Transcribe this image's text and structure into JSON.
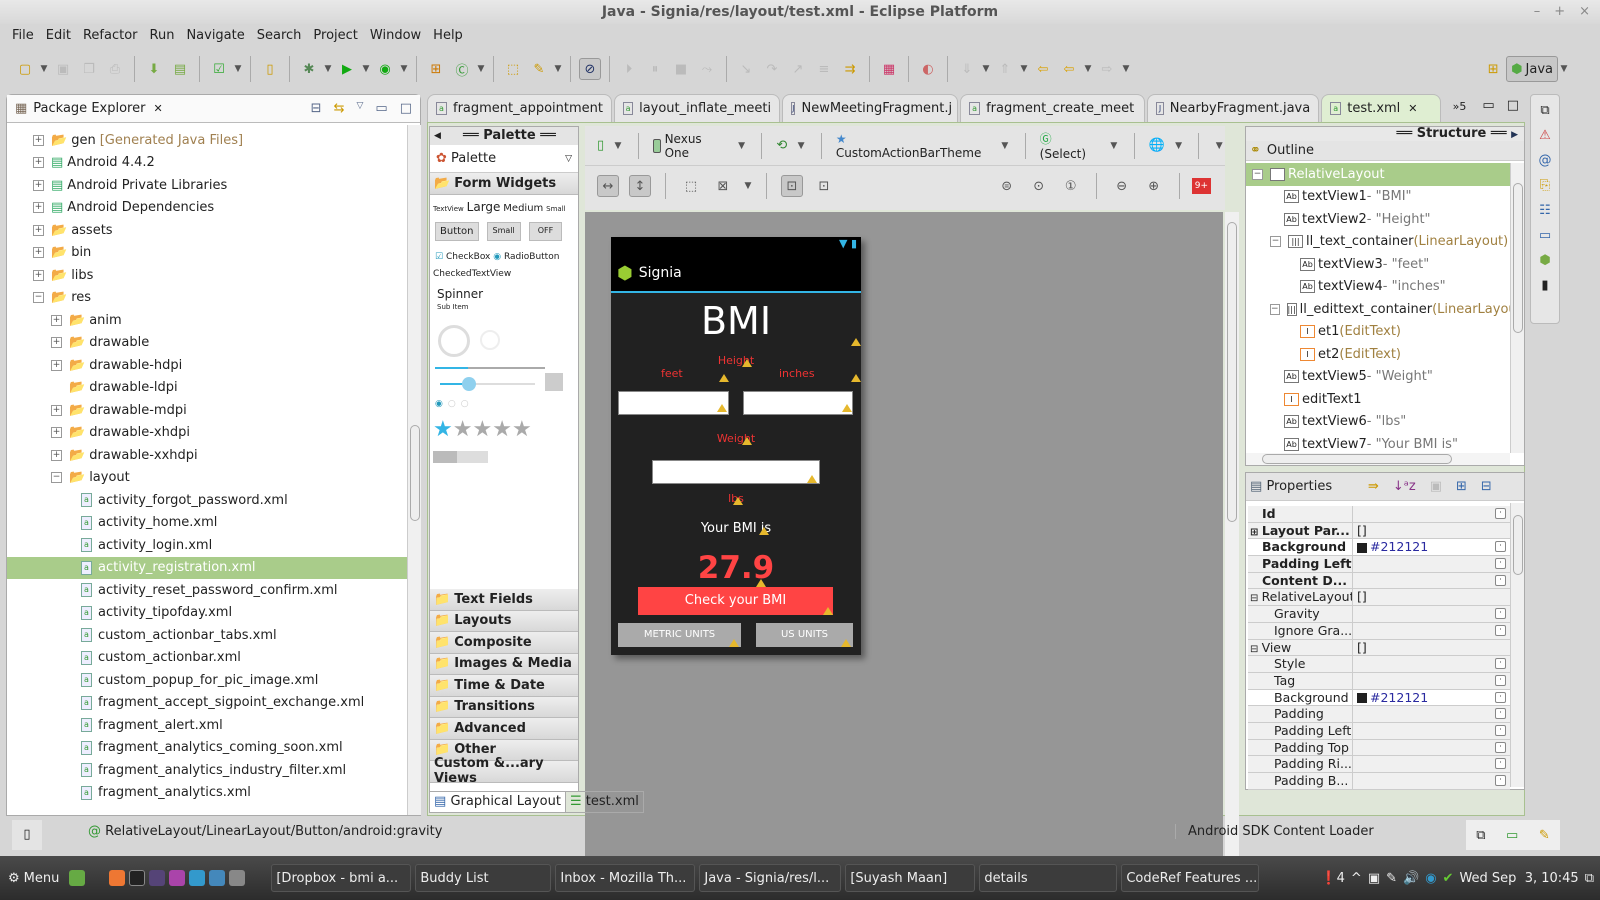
{
  "window": {
    "title": "Java - Signia/res/layout/test.xml - Eclipse Platform",
    "controls": [
      "–",
      "+",
      "×"
    ]
  },
  "menu": [
    "File",
    "Edit",
    "Refactor",
    "Run",
    "Navigate",
    "Search",
    "Project",
    "Window",
    "Help"
  ],
  "perspective": {
    "label": "Java"
  },
  "package_explorer": {
    "title": "Package Explorer",
    "items": [
      {
        "label": "gen",
        "suffix": "[Generated Java Files]",
        "level": 1,
        "expander": "+",
        "icon": "source-folder-icon"
      },
      {
        "label": "Android 4.4.2",
        "level": 1,
        "expander": "+",
        "icon": "library-icon"
      },
      {
        "label": "Android Private Libraries",
        "level": 1,
        "expander": "+",
        "icon": "library-icon"
      },
      {
        "label": "Android Dependencies",
        "level": 1,
        "expander": "+",
        "icon": "library-icon"
      },
      {
        "label": "assets",
        "level": 1,
        "expander": "+",
        "icon": "folder-icon"
      },
      {
        "label": "bin",
        "level": 1,
        "expander": "+",
        "icon": "folder-icon"
      },
      {
        "label": "libs",
        "level": 1,
        "expander": "+",
        "icon": "folder-icon"
      },
      {
        "label": "res",
        "level": 1,
        "expander": "−",
        "icon": "folder-icon"
      },
      {
        "label": "anim",
        "level": 2,
        "expander": "+",
        "icon": "folder-icon"
      },
      {
        "label": "drawable",
        "level": 2,
        "expander": "+",
        "icon": "folder-icon"
      },
      {
        "label": "drawable-hdpi",
        "level": 2,
        "expander": "+",
        "icon": "folder-icon"
      },
      {
        "label": "drawable-ldpi",
        "level": 2,
        "expander": "",
        "icon": "folder-icon"
      },
      {
        "label": "drawable-mdpi",
        "level": 2,
        "expander": "+",
        "icon": "folder-icon"
      },
      {
        "label": "drawable-xhdpi",
        "level": 2,
        "expander": "+",
        "icon": "folder-icon"
      },
      {
        "label": "drawable-xxhdpi",
        "level": 2,
        "expander": "+",
        "icon": "folder-icon"
      },
      {
        "label": "layout",
        "level": 2,
        "expander": "−",
        "icon": "folder-icon"
      },
      {
        "label": "activity_forgot_password.xml",
        "level": 3,
        "icon": "xml-file-icon"
      },
      {
        "label": "activity_home.xml",
        "level": 3,
        "icon": "xml-file-icon"
      },
      {
        "label": "activity_login.xml",
        "level": 3,
        "icon": "xml-file-icon"
      },
      {
        "label": "activity_registration.xml",
        "level": 3,
        "icon": "xml-file-icon",
        "selected": true
      },
      {
        "label": "activity_reset_password_confirm.xml",
        "level": 3,
        "icon": "xml-file-icon"
      },
      {
        "label": "activity_tipofday.xml",
        "level": 3,
        "icon": "xml-file-icon"
      },
      {
        "label": "custom_actionbar_tabs.xml",
        "level": 3,
        "icon": "xml-file-icon"
      },
      {
        "label": "custom_actionbar.xml",
        "level": 3,
        "icon": "xml-file-icon"
      },
      {
        "label": "custom_popup_for_pic_image.xml",
        "level": 3,
        "icon": "xml-file-icon"
      },
      {
        "label": "fragment_accept_sigpoint_exchange.xml",
        "level": 3,
        "icon": "xml-file-icon"
      },
      {
        "label": "fragment_alert.xml",
        "level": 3,
        "icon": "xml-file-icon"
      },
      {
        "label": "fragment_analytics_coming_soon.xml",
        "level": 3,
        "icon": "xml-file-icon"
      },
      {
        "label": "fragment_analytics_industry_filter.xml",
        "level": 3,
        "icon": "xml-file-icon"
      },
      {
        "label": "fragment_analytics.xml",
        "level": 3,
        "icon": "xml-file-icon"
      }
    ]
  },
  "editor_tabs": [
    {
      "label": "fragment_appointment",
      "icon": "xml-file-icon"
    },
    {
      "label": "layout_inflate_meeti",
      "icon": "xml-file-icon"
    },
    {
      "label": "NewMeetingFragment.j",
      "icon": "java-file-icon"
    },
    {
      "label": "fragment_create_meet",
      "icon": "xml-file-icon"
    },
    {
      "label": "NearbyFragment.java",
      "icon": "java-file-icon"
    },
    {
      "label": "test.xml",
      "icon": "xml-file-icon",
      "active": true
    }
  ],
  "overflow_tabs": "»5",
  "palette": {
    "header": "Palette",
    "dropdown": "Palette",
    "open_category": "Form Widgets",
    "preview": {
      "textview": "TextView",
      "large": "Large",
      "medium": "Medium",
      "small": "Small",
      "button": "Button",
      "small_button": "Small",
      "toggle": "OFF",
      "checkbox": "CheckBox",
      "radio": "RadioButton",
      "checked_textview": "CheckedTextView",
      "spinner": "Spinner",
      "spinner_sub": "Sub Item",
      "rating_stars": 5,
      "rating_value": 1
    },
    "categories": [
      "Text Fields",
      "Layouts",
      "Composite",
      "Images & Media",
      "Time & Date",
      "Transitions",
      "Advanced",
      "Other",
      "Custom &...ary Views"
    ]
  },
  "device_toolbar": {
    "device": "Nexus One",
    "theme": "CustomActionBarTheme",
    "activity": "(Select)",
    "badge": "9+"
  },
  "phone": {
    "app_title": "Signia",
    "heading": "BMI",
    "height_label": "Height",
    "feet_label": "feet",
    "inches_label": "inches",
    "weight_label": "Weight",
    "lbs_label": "lbs",
    "result_label": "Your BMI is",
    "result_value": "27.9",
    "check_button": "Check your BMI",
    "metric_button": "METRIC UNITS",
    "us_button": "US UNITS",
    "accent": "#ff4444"
  },
  "bottom_tabs": [
    "Graphical Layout",
    "test.xml"
  ],
  "outline": {
    "title": "Outline",
    "structure_header": "Structure",
    "items": [
      {
        "name": "RelativeLayout",
        "level": 0,
        "expander": "−",
        "selected": true
      },
      {
        "name": "textView1",
        "detail": " - \"BMI\"",
        "level": 1
      },
      {
        "name": "textView2",
        "detail": " - \"Height\"",
        "level": 1
      },
      {
        "name": "ll_text_container",
        "detail": " (LinearLayout)",
        "level": 1,
        "expander": "−",
        "type": "layout"
      },
      {
        "name": "textView3",
        "detail": " - \"feet\"",
        "level": 2
      },
      {
        "name": "textView4",
        "detail": " - \"inches\"",
        "level": 2
      },
      {
        "name": "ll_edittext_container",
        "detail": " (LinearLayout",
        "level": 1,
        "expander": "−",
        "type": "layout"
      },
      {
        "name": "et1",
        "detail": " (EditText)",
        "level": 2,
        "type": "edit"
      },
      {
        "name": "et2",
        "detail": " (EditText)",
        "level": 2,
        "type": "edit"
      },
      {
        "name": "textView5",
        "detail": " - \"Weight\"",
        "level": 1
      },
      {
        "name": "editText1",
        "detail": "",
        "level": 1,
        "type": "edit"
      },
      {
        "name": "textView6",
        "detail": " - \"lbs\"",
        "level": 1
      },
      {
        "name": "textView7",
        "detail": " - \"Your BMI is\"",
        "level": 1
      }
    ]
  },
  "properties": {
    "title": "Properties",
    "rows": [
      {
        "key": "Id",
        "value": "",
        "bold": true,
        "btn": true
      },
      {
        "key": "Layout Par...",
        "value": "[]",
        "bold": true,
        "expander": "+"
      },
      {
        "key": "Background",
        "value": "#212121",
        "bold": true,
        "btn": true,
        "swatch": true,
        "highlight": true
      },
      {
        "key": "Padding Left",
        "value": "",
        "bold": true,
        "btn": true
      },
      {
        "key": "Content D...",
        "value": "",
        "bold": true,
        "btn": true
      },
      {
        "key": "RelativeLayout",
        "value": "[]",
        "expander": "−",
        "group": true
      },
      {
        "key": "Gravity",
        "value": "",
        "btn": true,
        "indent": true
      },
      {
        "key": "Ignore Gra...",
        "value": "",
        "btn": true,
        "indent": true
      },
      {
        "key": "View",
        "value": "[]",
        "expander": "−",
        "group": true
      },
      {
        "key": "Style",
        "value": "",
        "btn": true,
        "indent": true
      },
      {
        "key": "Tag",
        "value": "",
        "btn": true,
        "indent": true
      },
      {
        "key": "Background",
        "value": "#212121",
        "btn": true,
        "indent": true,
        "swatch": true,
        "highlight": true
      },
      {
        "key": "Padding",
        "value": "",
        "btn": true,
        "indent": true
      },
      {
        "key": "Padding Left",
        "value": "",
        "btn": true,
        "indent": true
      },
      {
        "key": "Padding Top",
        "value": "",
        "btn": true,
        "indent": true
      },
      {
        "key": "Padding Ri...",
        "value": "",
        "btn": true,
        "indent": true
      },
      {
        "key": "Padding B...",
        "value": "",
        "btn": true,
        "indent": true
      }
    ]
  },
  "status": {
    "path": "RelativeLayout/LinearLayout/Button/android:gravity",
    "loader": "Android SDK Content Loader"
  },
  "taskbar": {
    "menu": "Menu",
    "tasks": [
      "[Dropbox - bmi a...",
      "Buddy List",
      "Inbox - Mozilla Th...",
      "Java - Signia/res/l...",
      "[Suyash Maan]",
      "details",
      "CodeRef Features ..."
    ],
    "notif_count": "4",
    "clock": "Wed Sep  3, 10:45"
  }
}
